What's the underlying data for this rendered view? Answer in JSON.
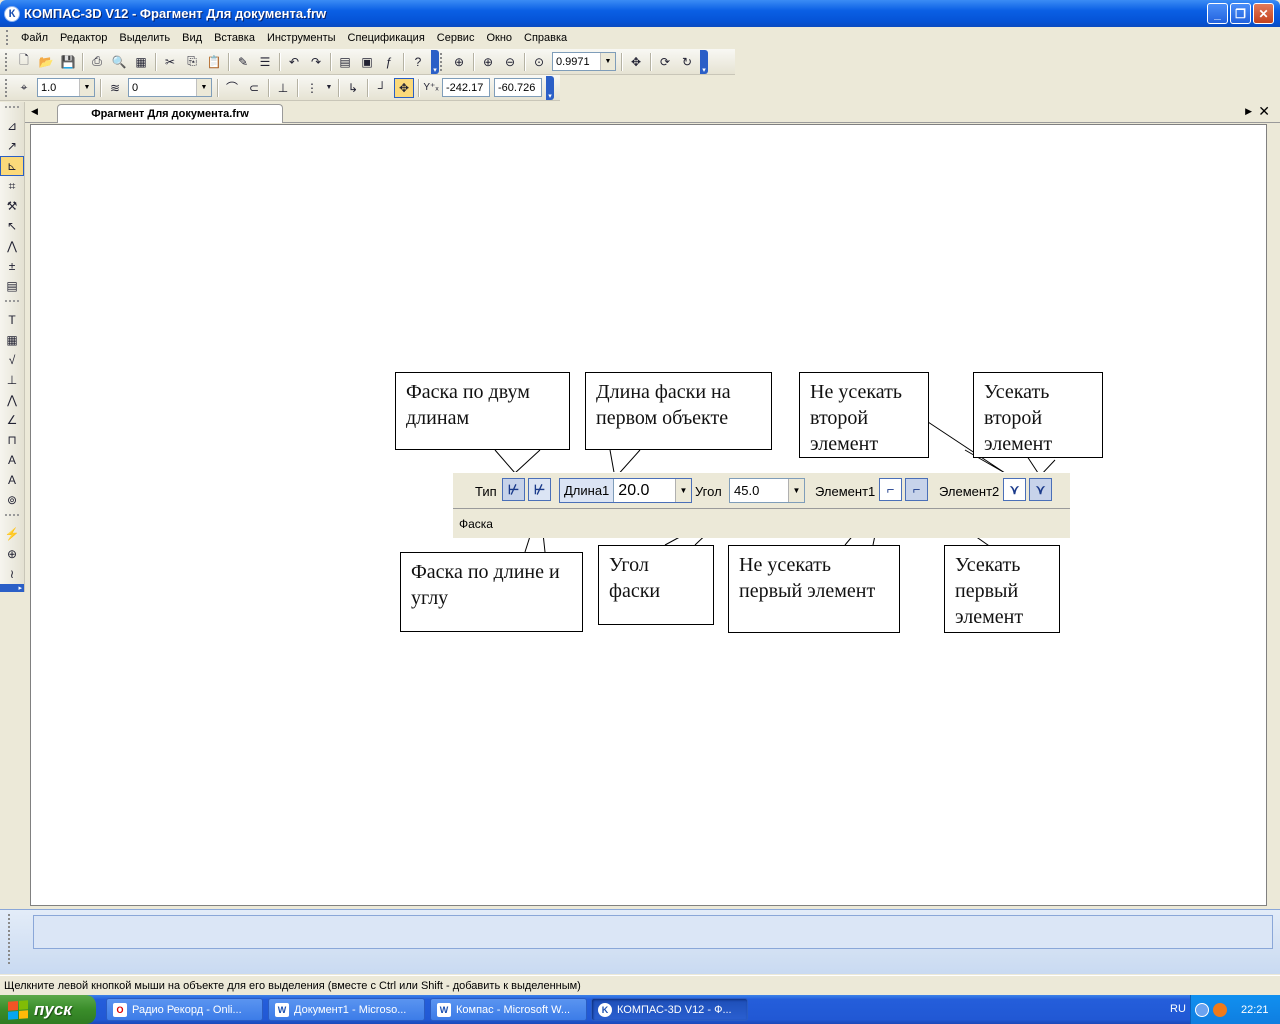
{
  "window": {
    "title": "КОМПАС-3D V12 - Фрагмент Для документа.frw",
    "app_icon": "К",
    "minimize": "_",
    "restore": "❐",
    "close": "✕"
  },
  "menu": [
    "Файл",
    "Редактор",
    "Выделить",
    "Вид",
    "Вставка",
    "Инструменты",
    "Спецификация",
    "Сервис",
    "Окно",
    "Справка"
  ],
  "toolbar": {
    "zoom_value": "0.9971",
    "step_value": "1.0",
    "layer_value": "0",
    "coord_x": "-242.17",
    "coord_y": "-60.726",
    "coord_label": "Y⁺ₓ"
  },
  "document_tab": {
    "label": "Фрагмент Для документа.frw"
  },
  "figure": {
    "callouts": {
      "two_lengths": "Фаска по двум длинам",
      "length1": "Длина фаски на первом объекте",
      "no_trim_second": "Не усекать второй элемент",
      "trim_second": "Усекать второй элемент",
      "length_angle": "Фаска по длине и углу",
      "angle": "Угол фаски",
      "no_trim_first": "Не усекать первый элемент",
      "trim_first": "Усекать первый элемент"
    },
    "panel": {
      "type_label": "Тип",
      "length1_label": "Длина1",
      "length1_value": "20.0",
      "angle_label": "Угол",
      "angle_value": "45.0",
      "element1_label": "Элемент1",
      "element2_label": "Элемент2",
      "tab_label": "Фаска"
    }
  },
  "status": {
    "hint": "Щелкните левой кнопкой мыши на объекте для его выделения (вместе с Ctrl или Shift - добавить к выделенным)"
  },
  "taskbar": {
    "start_label": "пуск",
    "tasks": [
      "Радио Рекорд - Onli...",
      "Документ1 - Microso...",
      "Компас - Microsoft W...",
      "КОМПАС-3D V12 - Ф..."
    ],
    "language": "RU",
    "clock": "22:21"
  }
}
